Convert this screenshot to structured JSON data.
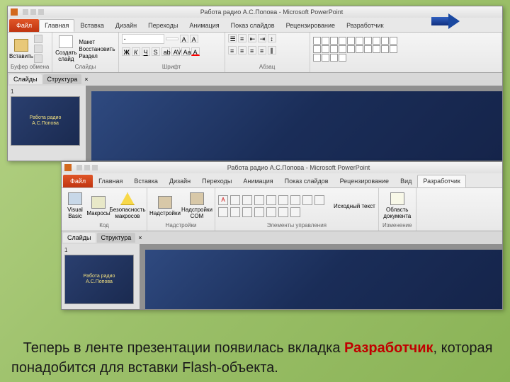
{
  "app_title": "Работа радио А.С.Попова - Microsoft PowerPoint",
  "file_tab": "Файл",
  "tabs": [
    "Главная",
    "Вставка",
    "Дизайн",
    "Переходы",
    "Анимация",
    "Показ слайдов",
    "Рецензирование",
    "Вид",
    "Разработчик"
  ],
  "shot1_active": 0,
  "shot2_active": 8,
  "panel": {
    "slides": "Слайды",
    "structure": "Структура"
  },
  "thumb_num": "1",
  "thumb_title_line1": "Работа радио",
  "thumb_title_line2": "А.С.Попова",
  "groups1": {
    "clipboard": "Буфер обмена",
    "clipboard_btn": "Вставить",
    "slides": "Слайды",
    "slides_btn": "Создать слайд",
    "slides_opts": [
      "Макет",
      "Восстановить",
      "Раздел"
    ],
    "font": "Шрифт",
    "font_box": "- ",
    "font_size": "A",
    "paragraph": "Абзац"
  },
  "groups2": {
    "code": "Код",
    "vb": "Visual Basic",
    "macros": "Макросы",
    "sec": "Безопасность макросов",
    "addins": "Надстройки",
    "add1": "Надстройки",
    "add2": "Надстройки COM",
    "controls": "Элементы управления",
    "alt_text": "Исходный текст",
    "modify": "Изменение",
    "doc_area": "Область документа"
  },
  "caption": {
    "part1": "Теперь в ленте презентации появилась вкладка ",
    "red": "Разработчик",
    "part2": ", которая понадобится для вставки Flash-объекта."
  }
}
